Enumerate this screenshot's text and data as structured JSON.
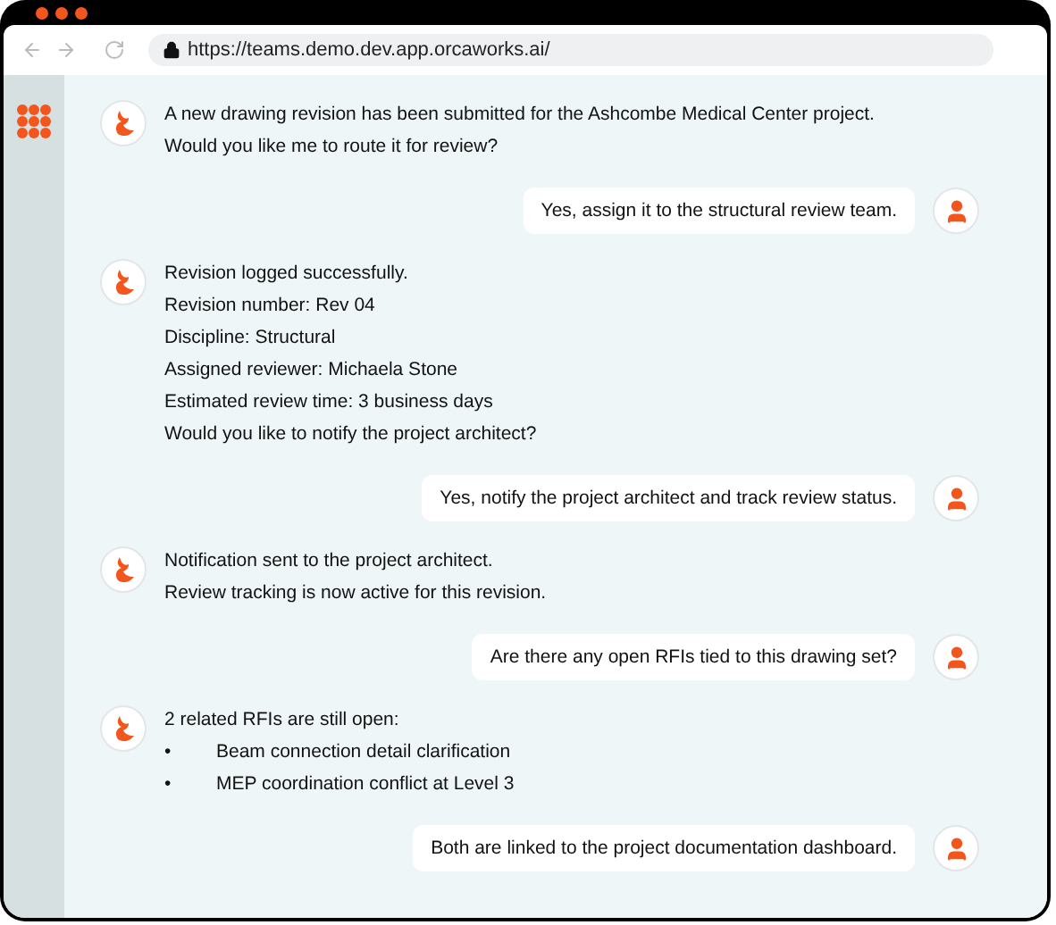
{
  "browser": {
    "url": "https://teams.demo.dev.app.orcaworks.ai/"
  },
  "messages": [
    {
      "kind": "bot",
      "lines": [
        "A new drawing revision has been submitted for the Ashcombe Medical Center project.",
        "Would you like me to route it for review?"
      ]
    },
    {
      "kind": "user",
      "text": "Yes, assign it to the structural review team."
    },
    {
      "kind": "bot",
      "lines": [
        "Revision logged successfully.",
        "Revision number: Rev 04",
        "Discipline: Structural",
        "Assigned reviewer: Michaela Stone",
        "Estimated review time: 3 business days",
        "Would you like to notify the project architect?"
      ]
    },
    {
      "kind": "user",
      "text": "Yes, notify the project architect and track review status."
    },
    {
      "kind": "bot",
      "lines": [
        "Notification sent to the project architect.",
        "Review tracking is now active for this revision."
      ]
    },
    {
      "kind": "user",
      "text": "Are there any open RFIs tied to this drawing set?"
    },
    {
      "kind": "bot",
      "lines": [
        "2 related RFIs are still open:"
      ],
      "bullets": [
        {
          "marker": "•",
          "text": "Beam connection detail clarification"
        },
        {
          "marker": "•",
          "text": "MEP coordination conflict at Level 3"
        }
      ]
    },
    {
      "kind": "user",
      "text": "Both are linked to the project documentation dashboard."
    }
  ]
}
